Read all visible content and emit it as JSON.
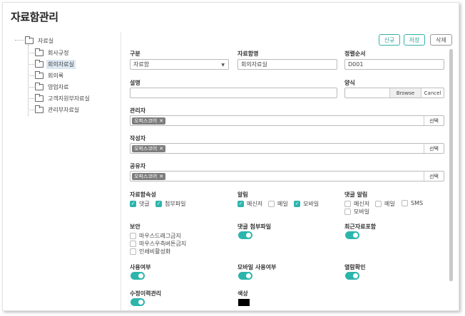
{
  "page_title": "자료함관리",
  "tree": {
    "root": "자료실",
    "items": [
      "회사규정",
      "회의자료실",
      "회의록",
      "영업자료",
      "고객지원부자료실",
      "관리부자료실"
    ],
    "selected_index": 1
  },
  "toolbar": {
    "new_label": "신규",
    "save_label": "저장",
    "delete_label": "삭제"
  },
  "form": {
    "category": {
      "label": "구분",
      "value": "자료함"
    },
    "name": {
      "label": "자료함명",
      "value": "회의자료실"
    },
    "order": {
      "label": "정렬순서",
      "value": "D001"
    },
    "description": {
      "label": "설명",
      "value": ""
    },
    "template": {
      "label": "양식",
      "value": "",
      "browse_label": "Browse",
      "cancel_label": "Cancel"
    },
    "manager": {
      "label": "관리자",
      "tag": "오피스코어",
      "select_label": "선택"
    },
    "author": {
      "label": "작성자",
      "tag": "오피스코어",
      "select_label": "선택"
    },
    "sharer": {
      "label": "공유자",
      "tag": "오피스코어",
      "select_label": "선택"
    },
    "attributes": {
      "label": "자료함속성",
      "options": [
        {
          "label": "댓글",
          "checked": true
        },
        {
          "label": "첨부파일",
          "checked": true
        }
      ]
    },
    "notification": {
      "label": "알림",
      "options": [
        {
          "label": "메신저",
          "checked": true
        },
        {
          "label": "메일",
          "checked": false
        },
        {
          "label": "모바일",
          "checked": true
        }
      ]
    },
    "comment_notification": {
      "label": "댓글 알림",
      "options": [
        {
          "label": "메신저",
          "checked": false
        },
        {
          "label": "메일",
          "checked": false
        },
        {
          "label": "SMS",
          "checked": false
        },
        {
          "label": "모바일",
          "checked": false
        }
      ]
    },
    "security": {
      "label": "보안",
      "options": [
        {
          "label": "마우스드래그금지",
          "checked": false
        },
        {
          "label": "마우스우측버튼금지",
          "checked": false
        },
        {
          "label": "인쇄비활성화",
          "checked": false
        }
      ]
    },
    "comment_attachment": {
      "label": "댓글 첨부파일",
      "on": true
    },
    "recent_include": {
      "label": "최근자료포함",
      "on": true
    },
    "use": {
      "label": "사용여부",
      "on": true
    },
    "mobile_use": {
      "label": "모바일 사용여부",
      "on": true
    },
    "read_check": {
      "label": "열람확인",
      "on": true
    },
    "edit_history": {
      "label": "수정이력관리",
      "on": true
    },
    "color": {
      "label": "색상",
      "value": "#000000"
    }
  },
  "colors": {
    "accent": "#2bb5ac",
    "tag_bg": "#7d7d7d",
    "selected_bg": "#dde8f3"
  }
}
